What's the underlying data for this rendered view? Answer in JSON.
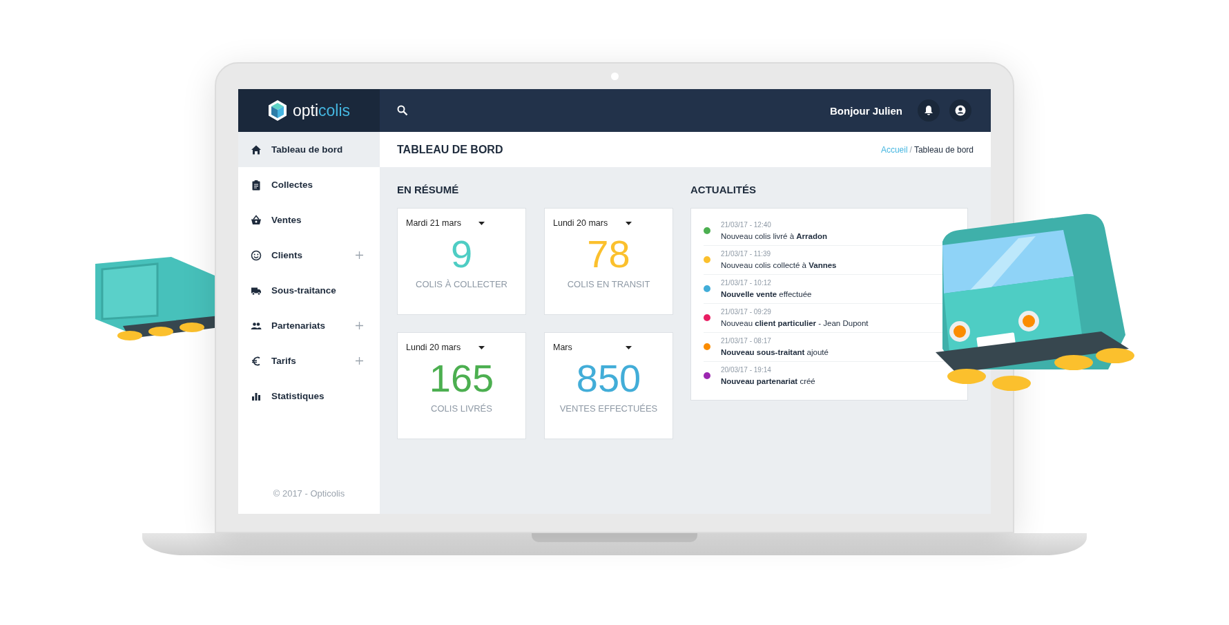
{
  "top_bar": {
    "logo": {
      "prefix": "opti",
      "suffix": "colis"
    },
    "greeting": "Bonjour Julien"
  },
  "sidebar": {
    "items": [
      {
        "label": "Tableau de bord",
        "selected": true,
        "has_submenu": false
      },
      {
        "label": "Collectes",
        "selected": false,
        "has_submenu": false
      },
      {
        "label": "Ventes",
        "selected": false,
        "has_submenu": false
      },
      {
        "label": "Clients",
        "selected": false,
        "has_submenu": true
      },
      {
        "label": "Sous-traitance",
        "selected": false,
        "has_submenu": false
      },
      {
        "label": "Partenariats",
        "selected": false,
        "has_submenu": true
      },
      {
        "label": "Tarifs",
        "selected": false,
        "has_submenu": true
      },
      {
        "label": "Statistiques",
        "selected": false,
        "has_submenu": false
      }
    ],
    "footer": "© 2017 - Opticolis"
  },
  "page_header": {
    "title": "TABLEAU DE BORD",
    "breadcrumb": {
      "link": "Accueil",
      "separator": "/",
      "current": "Tableau de bord"
    }
  },
  "summary": {
    "title": "EN RÉSUMÉ",
    "cards": [
      {
        "period": "Mardi 21 mars",
        "value": "9",
        "label": "COLIS À COLLECTER",
        "color": "#4ecdc4"
      },
      {
        "period": "Lundi 20 mars",
        "value": "78",
        "label": "COLIS EN TRANSIT",
        "color": "#fbc02d"
      },
      {
        "period": "Lundi 20 mars",
        "value": "165",
        "label": "COLIS LIVRÉS",
        "color": "#4caf50"
      },
      {
        "period": "Mars",
        "value": "850",
        "label": "VENTES EFFECTUÉES",
        "color": "#42add8"
      }
    ]
  },
  "news": {
    "title": "ACTUALITÉS",
    "items": [
      {
        "time": "21/03/17 - 12:40",
        "text": "Nouveau colis livré à **Arradon**",
        "color": "#4caf50"
      },
      {
        "time": "21/03/17 - 11:39",
        "text": "Nouveau colis collecté à **Vannes**",
        "color": "#fbc02d"
      },
      {
        "time": "21/03/17 - 10:12",
        "text": "**Nouvelle vente** effectuée",
        "color": "#42add8"
      },
      {
        "time": "21/03/17 - 09:29",
        "text": "Nouveau **client particulier** - Jean Dupont",
        "color": "#e91e63"
      },
      {
        "time": "21/03/17 - 08:17",
        "text": "**Nouveau sous-traitant** ajouté",
        "color": "#fb8c00"
      },
      {
        "time": "20/03/17 - 19:14",
        "text": "**Nouveau partenariat** créé",
        "color": "#9c27b0"
      }
    ]
  }
}
